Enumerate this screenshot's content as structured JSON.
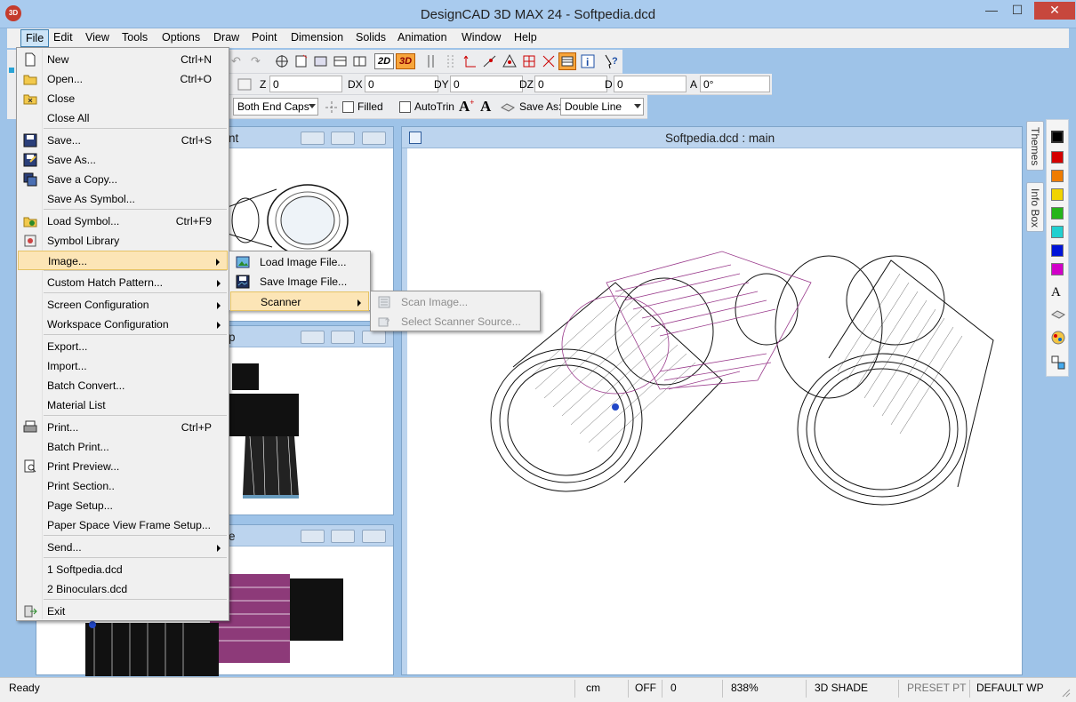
{
  "window": {
    "title": "DesignCAD 3D MAX 24 - Softpedia.dcd",
    "app_icon_text": "3D",
    "minimize": "—",
    "maximize": "☐",
    "close": "✕"
  },
  "menubar": {
    "items": [
      "File",
      "Edit",
      "View",
      "Tools",
      "Options",
      "Draw",
      "Point",
      "Dimension",
      "Solids",
      "Animation",
      "Window",
      "Help"
    ]
  },
  "toolbar": {
    "mode_2d": "2D",
    "mode_3d": "3D",
    "coords": [
      {
        "label": "Z",
        "value": "0"
      },
      {
        "label": "DX",
        "value": "0"
      },
      {
        "label": "DY",
        "value": "0"
      },
      {
        "label": "DZ",
        "value": "0"
      },
      {
        "label": "D",
        "value": "0"
      },
      {
        "label": "A",
        "value": "0°"
      }
    ],
    "end_caps": "Both End Caps",
    "filled_label": "Filled",
    "autotrim_label": "AutoTrin",
    "save_as_label": "Save As:",
    "save_as_value": "Double Line"
  },
  "file_menu": {
    "items": [
      {
        "label": "New",
        "accel": "Ctrl+N",
        "icon": "new-file-icon"
      },
      {
        "label": "Open...",
        "accel": "Ctrl+O",
        "icon": "open-folder-icon"
      },
      {
        "label": "Close",
        "accel": "",
        "icon": "close-folder-icon"
      },
      {
        "label": "Close All",
        "accel": "",
        "icon": ""
      },
      {
        "label": "Save...",
        "accel": "Ctrl+S",
        "icon": "save-icon"
      },
      {
        "label": "Save As...",
        "accel": "",
        "icon": "save-as-icon"
      },
      {
        "label": "Save a Copy...",
        "accel": "",
        "icon": "save-copy-icon"
      },
      {
        "label": "Save As Symbol...",
        "accel": "",
        "icon": ""
      },
      {
        "label": "Load Symbol...",
        "accel": "Ctrl+F9",
        "icon": "load-symbol-icon"
      },
      {
        "label": "Symbol Library",
        "accel": "",
        "icon": "symbol-library-icon"
      },
      {
        "label": "Image...",
        "accel": "",
        "icon": ""
      },
      {
        "label": "Custom Hatch Pattern...",
        "accel": "",
        "icon": ""
      },
      {
        "label": "Screen Configuration",
        "accel": "",
        "icon": ""
      },
      {
        "label": "Workspace Configuration",
        "accel": "",
        "icon": ""
      },
      {
        "label": "Export...",
        "accel": "",
        "icon": ""
      },
      {
        "label": "Import...",
        "accel": "",
        "icon": ""
      },
      {
        "label": "Batch Convert...",
        "accel": "",
        "icon": ""
      },
      {
        "label": "Material List",
        "accel": "",
        "icon": ""
      },
      {
        "label": "Print...",
        "accel": "Ctrl+P",
        "icon": "print-icon"
      },
      {
        "label": "Batch Print...",
        "accel": "",
        "icon": ""
      },
      {
        "label": "Print Preview...",
        "accel": "",
        "icon": "print-preview-icon"
      },
      {
        "label": "Print Section..",
        "accel": "",
        "icon": ""
      },
      {
        "label": "Page Setup...",
        "accel": "",
        "icon": ""
      },
      {
        "label": "Paper Space View Frame Setup...",
        "accel": "",
        "icon": ""
      },
      {
        "label": "Send...",
        "accel": "",
        "icon": ""
      },
      {
        "label": "1 Softpedia.dcd",
        "accel": "",
        "icon": ""
      },
      {
        "label": "2 Binoculars.dcd",
        "accel": "",
        "icon": ""
      },
      {
        "label": "Exit",
        "accel": "",
        "icon": "exit-icon"
      }
    ]
  },
  "image_menu": {
    "items": [
      "Load Image File...",
      "Save Image File...",
      "Scanner"
    ]
  },
  "scanner_menu": {
    "items": [
      "Scan Image...",
      "Select Scanner Source..."
    ]
  },
  "subwindows": {
    "top_caption": "nt",
    "middle_caption": "p",
    "bottom_caption": "e",
    "main_caption": "Softpedia.dcd : main"
  },
  "side_tabs": [
    "Themes",
    "Info Box"
  ],
  "palette_colors": [
    "#000000",
    "#d40000",
    "#ef7c00",
    "#f1d400",
    "#25b51a",
    "#20d0d0",
    "#0014d8",
    "#d100c9"
  ],
  "statusbar": {
    "ready": "Ready",
    "unit": "cm",
    "snap": "OFF",
    "value": "0",
    "zoom": "838%",
    "shade": "3D SHADE",
    "preset": "PRESET PT",
    "workplane": "DEFAULT WP"
  }
}
